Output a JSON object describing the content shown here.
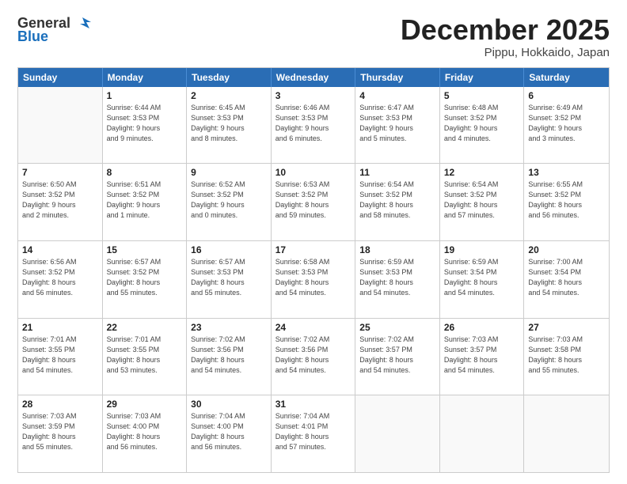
{
  "logo": {
    "general": "General",
    "blue": "Blue"
  },
  "title": "December 2025",
  "subtitle": "Pippu, Hokkaido, Japan",
  "days": [
    "Sunday",
    "Monday",
    "Tuesday",
    "Wednesday",
    "Thursday",
    "Friday",
    "Saturday"
  ],
  "weeks": [
    [
      {
        "day": "",
        "info": ""
      },
      {
        "day": "1",
        "info": "Sunrise: 6:44 AM\nSunset: 3:53 PM\nDaylight: 9 hours\nand 9 minutes."
      },
      {
        "day": "2",
        "info": "Sunrise: 6:45 AM\nSunset: 3:53 PM\nDaylight: 9 hours\nand 8 minutes."
      },
      {
        "day": "3",
        "info": "Sunrise: 6:46 AM\nSunset: 3:53 PM\nDaylight: 9 hours\nand 6 minutes."
      },
      {
        "day": "4",
        "info": "Sunrise: 6:47 AM\nSunset: 3:53 PM\nDaylight: 9 hours\nand 5 minutes."
      },
      {
        "day": "5",
        "info": "Sunrise: 6:48 AM\nSunset: 3:52 PM\nDaylight: 9 hours\nand 4 minutes."
      },
      {
        "day": "6",
        "info": "Sunrise: 6:49 AM\nSunset: 3:52 PM\nDaylight: 9 hours\nand 3 minutes."
      }
    ],
    [
      {
        "day": "7",
        "info": "Sunrise: 6:50 AM\nSunset: 3:52 PM\nDaylight: 9 hours\nand 2 minutes."
      },
      {
        "day": "8",
        "info": "Sunrise: 6:51 AM\nSunset: 3:52 PM\nDaylight: 9 hours\nand 1 minute."
      },
      {
        "day": "9",
        "info": "Sunrise: 6:52 AM\nSunset: 3:52 PM\nDaylight: 9 hours\nand 0 minutes."
      },
      {
        "day": "10",
        "info": "Sunrise: 6:53 AM\nSunset: 3:52 PM\nDaylight: 8 hours\nand 59 minutes."
      },
      {
        "day": "11",
        "info": "Sunrise: 6:54 AM\nSunset: 3:52 PM\nDaylight: 8 hours\nand 58 minutes."
      },
      {
        "day": "12",
        "info": "Sunrise: 6:54 AM\nSunset: 3:52 PM\nDaylight: 8 hours\nand 57 minutes."
      },
      {
        "day": "13",
        "info": "Sunrise: 6:55 AM\nSunset: 3:52 PM\nDaylight: 8 hours\nand 56 minutes."
      }
    ],
    [
      {
        "day": "14",
        "info": "Sunrise: 6:56 AM\nSunset: 3:52 PM\nDaylight: 8 hours\nand 56 minutes."
      },
      {
        "day": "15",
        "info": "Sunrise: 6:57 AM\nSunset: 3:52 PM\nDaylight: 8 hours\nand 55 minutes."
      },
      {
        "day": "16",
        "info": "Sunrise: 6:57 AM\nSunset: 3:53 PM\nDaylight: 8 hours\nand 55 minutes."
      },
      {
        "day": "17",
        "info": "Sunrise: 6:58 AM\nSunset: 3:53 PM\nDaylight: 8 hours\nand 54 minutes."
      },
      {
        "day": "18",
        "info": "Sunrise: 6:59 AM\nSunset: 3:53 PM\nDaylight: 8 hours\nand 54 minutes."
      },
      {
        "day": "19",
        "info": "Sunrise: 6:59 AM\nSunset: 3:54 PM\nDaylight: 8 hours\nand 54 minutes."
      },
      {
        "day": "20",
        "info": "Sunrise: 7:00 AM\nSunset: 3:54 PM\nDaylight: 8 hours\nand 54 minutes."
      }
    ],
    [
      {
        "day": "21",
        "info": "Sunrise: 7:01 AM\nSunset: 3:55 PM\nDaylight: 8 hours\nand 54 minutes."
      },
      {
        "day": "22",
        "info": "Sunrise: 7:01 AM\nSunset: 3:55 PM\nDaylight: 8 hours\nand 53 minutes."
      },
      {
        "day": "23",
        "info": "Sunrise: 7:02 AM\nSunset: 3:56 PM\nDaylight: 8 hours\nand 54 minutes."
      },
      {
        "day": "24",
        "info": "Sunrise: 7:02 AM\nSunset: 3:56 PM\nDaylight: 8 hours\nand 54 minutes."
      },
      {
        "day": "25",
        "info": "Sunrise: 7:02 AM\nSunset: 3:57 PM\nDaylight: 8 hours\nand 54 minutes."
      },
      {
        "day": "26",
        "info": "Sunrise: 7:03 AM\nSunset: 3:57 PM\nDaylight: 8 hours\nand 54 minutes."
      },
      {
        "day": "27",
        "info": "Sunrise: 7:03 AM\nSunset: 3:58 PM\nDaylight: 8 hours\nand 55 minutes."
      }
    ],
    [
      {
        "day": "28",
        "info": "Sunrise: 7:03 AM\nSunset: 3:59 PM\nDaylight: 8 hours\nand 55 minutes."
      },
      {
        "day": "29",
        "info": "Sunrise: 7:03 AM\nSunset: 4:00 PM\nDaylight: 8 hours\nand 56 minutes."
      },
      {
        "day": "30",
        "info": "Sunrise: 7:04 AM\nSunset: 4:00 PM\nDaylight: 8 hours\nand 56 minutes."
      },
      {
        "day": "31",
        "info": "Sunrise: 7:04 AM\nSunset: 4:01 PM\nDaylight: 8 hours\nand 57 minutes."
      },
      {
        "day": "",
        "info": ""
      },
      {
        "day": "",
        "info": ""
      },
      {
        "day": "",
        "info": ""
      }
    ]
  ]
}
